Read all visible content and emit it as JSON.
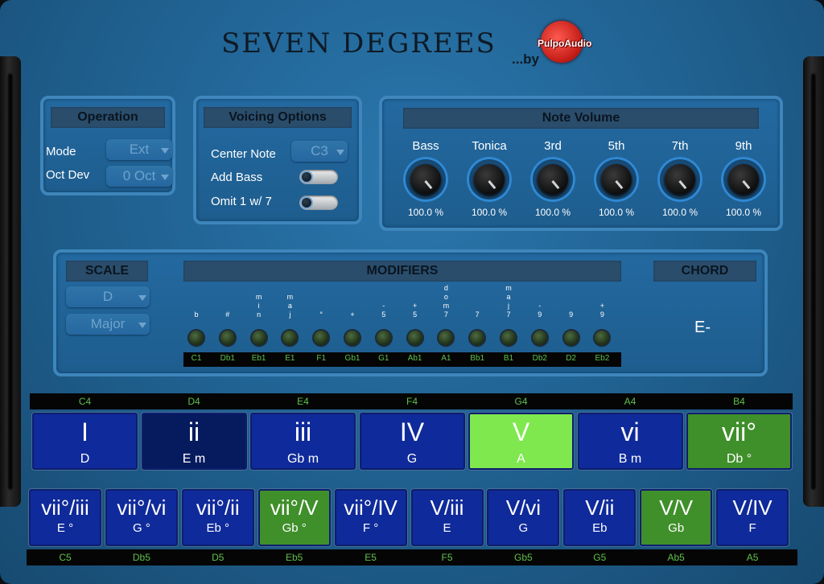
{
  "header": {
    "title": "SEVEN DEGREES",
    "by": "...by",
    "logo_text": "PulpoAudio"
  },
  "operation": {
    "title": "Operation",
    "mode_label": "Mode",
    "mode_value": "Ext",
    "octdev_label": "Oct Dev",
    "octdev_value": "0 Oct"
  },
  "voicing": {
    "title": "Voicing Options",
    "center_note_label": "Center Note",
    "center_note_value": "C3",
    "add_bass_label": "Add Bass",
    "add_bass_on": false,
    "omit_label": "Omit 1 w/ 7",
    "omit_on": false
  },
  "note_volume": {
    "title": "Note Volume",
    "knobs": [
      {
        "label": "Bass",
        "value": "100.0 %"
      },
      {
        "label": "Tonica",
        "value": "100.0 %"
      },
      {
        "label": "3rd",
        "value": "100.0 %"
      },
      {
        "label": "5th",
        "value": "100.0 %"
      },
      {
        "label": "7th",
        "value": "100.0 %"
      },
      {
        "label": "9th",
        "value": "100.0 %"
      }
    ]
  },
  "scale": {
    "title": "SCALE",
    "key": "D",
    "mode": "Major"
  },
  "modifiers": {
    "title": "MODIFIERS",
    "items": [
      {
        "label": "b",
        "note": "C1"
      },
      {
        "label": "#",
        "note": "Db1"
      },
      {
        "label": "m\ni\nn",
        "note": "Eb1"
      },
      {
        "label": "m\na\nj",
        "note": "E1"
      },
      {
        "label": "°",
        "note": "F1"
      },
      {
        "label": "+",
        "note": "Gb1"
      },
      {
        "label": "-\n5",
        "note": "G1"
      },
      {
        "label": "+\n5",
        "note": "Ab1"
      },
      {
        "label": "d\no\nm\n7",
        "note": "A1"
      },
      {
        "label": "7",
        "note": "Bb1"
      },
      {
        "label": "m\na\nj\n7",
        "note": "B1"
      },
      {
        "label": "-\n9",
        "note": "Db2"
      },
      {
        "label": "9",
        "note": "D2"
      },
      {
        "label": "+\n9",
        "note": "Eb2"
      }
    ]
  },
  "chord": {
    "title": "CHORD",
    "value": "E-"
  },
  "degrees_top": {
    "notes": [
      "C4",
      "D4",
      "E4",
      "F4",
      "G4",
      "A4",
      "B4"
    ],
    "items": [
      {
        "numeral": "I",
        "chord": "D",
        "color": "#0f2a9a"
      },
      {
        "numeral": "ii",
        "chord": "E  m",
        "color": "#061a5e"
      },
      {
        "numeral": "iii",
        "chord": "Gb  m",
        "color": "#0f2a9a"
      },
      {
        "numeral": "IV",
        "chord": "G",
        "color": "#0f2a9a"
      },
      {
        "numeral": "V",
        "chord": "A",
        "color": "#7ee84e"
      },
      {
        "numeral": "vi",
        "chord": "B  m",
        "color": "#0f2a9a"
      },
      {
        "numeral": "vii°",
        "chord": "Db  °",
        "color": "#3f8f2a"
      }
    ]
  },
  "degrees_bottom": {
    "notes": [
      "C5",
      "Db5",
      "D5",
      "Eb5",
      "E5",
      "F5",
      "Gb5",
      "G5",
      "Ab5",
      "A5"
    ],
    "items": [
      {
        "numeral": "vii°/iii",
        "chord": "E  °",
        "color": "#0f2a9a"
      },
      {
        "numeral": "vii°/vi",
        "chord": "G  °",
        "color": "#0f2a9a"
      },
      {
        "numeral": "vii°/ii",
        "chord": "Eb  °",
        "color": "#0f2a9a"
      },
      {
        "numeral": "vii°/V",
        "chord": "Gb  °",
        "color": "#3f8f2a"
      },
      {
        "numeral": "vii°/IV",
        "chord": "F  °",
        "color": "#0f2a9a"
      },
      {
        "numeral": "V/iii",
        "chord": "E",
        "color": "#0f2a9a"
      },
      {
        "numeral": "V/vi",
        "chord": "G",
        "color": "#0f2a9a"
      },
      {
        "numeral": "V/ii",
        "chord": "Eb",
        "color": "#0f2a9a"
      },
      {
        "numeral": "V/V",
        "chord": "Gb",
        "color": "#3f8f2a"
      },
      {
        "numeral": "V/IV",
        "chord": "F",
        "color": "#0f2a9a"
      }
    ]
  }
}
